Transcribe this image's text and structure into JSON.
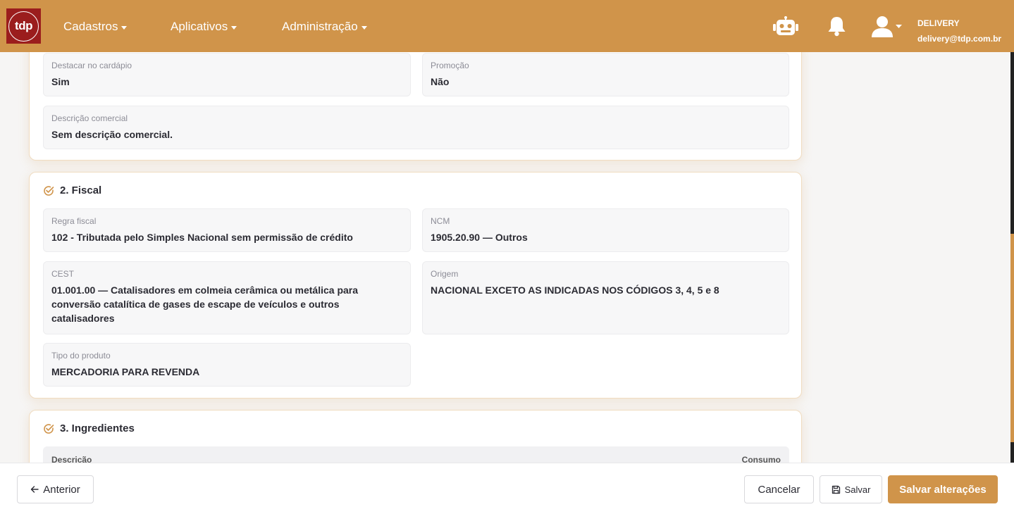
{
  "topbar": {
    "logo_text": "tdp",
    "nav": [
      {
        "label": "Cadastros"
      },
      {
        "label": "Aplicativos"
      },
      {
        "label": "Administração"
      }
    ],
    "user": {
      "name": "DELIVERY",
      "email": "delivery@tdp.com.br"
    }
  },
  "section1": {
    "fields": {
      "destacar": {
        "label": "Destacar no cardápio",
        "value": "Sim"
      },
      "promocao": {
        "label": "Promoção",
        "value": "Não"
      },
      "descricao": {
        "label": "Descrição comercial",
        "value": "Sem descrição comercial."
      }
    }
  },
  "section2": {
    "title": "2. Fiscal",
    "fields": {
      "regra": {
        "label": "Regra fiscal",
        "value": "102 - Tributada pelo Simples Nacional sem permissão de crédito"
      },
      "ncm": {
        "label": "NCM",
        "value": "1905.20.90 — Outros"
      },
      "cest": {
        "label": "CEST",
        "value": "01.001.00 — Catalisadores em colmeia cerâmica ou metálica para conversão catalítica de gases de escape de veículos e outros catalisadores"
      },
      "origem": {
        "label": "Origem",
        "value": "NACIONAL EXCETO AS INDICADAS NOS CÓDIGOS 3, 4, 5 e 8"
      },
      "tipo": {
        "label": "Tipo do produto",
        "value": "MERCADORIA PARA REVENDA"
      }
    }
  },
  "section3": {
    "title": "3. Ingredientes",
    "columns": [
      "Descrição",
      "Consumo"
    ]
  },
  "footer": {
    "prev_label": "Anterior",
    "cancel_label": "Cancelar",
    "save_label": "Salvar",
    "save_changes_label": "Salvar alterações"
  },
  "colors": {
    "accent": "#d0944a",
    "logo_bg": "#9b1d1d"
  }
}
